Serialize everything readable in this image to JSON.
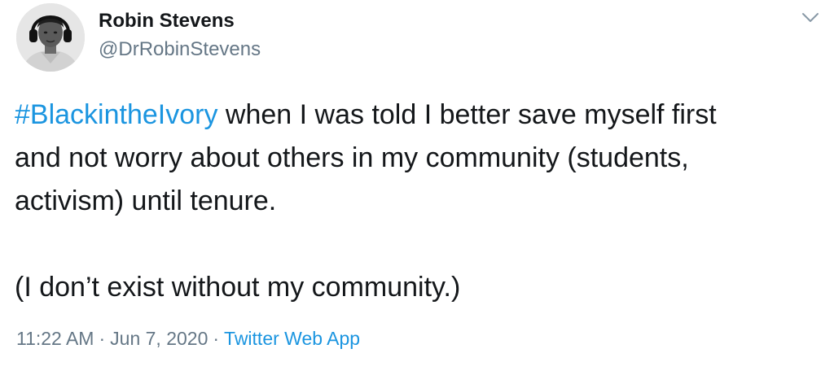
{
  "author": {
    "name": "Robin Stevens",
    "handle": "@DrRobinStevens"
  },
  "tweet": {
    "hashtag": "#BlackintheIvory",
    "line1_rest": " when I was told I better save myself first",
    "line2": "and not worry about others in my community (students,",
    "line3": "activism) until tenure.",
    "paragraph2": "(I don’t exist without my community.)"
  },
  "meta": {
    "time": "11:22 AM",
    "separator": "·",
    "date": "Jun 7, 2020",
    "source": "Twitter Web App"
  },
  "icons": {
    "menu": "chevron-down-icon",
    "avatar": "profile-photo"
  },
  "colors": {
    "link": "#1b95e0",
    "text": "#14171a",
    "muted": "#657786"
  }
}
